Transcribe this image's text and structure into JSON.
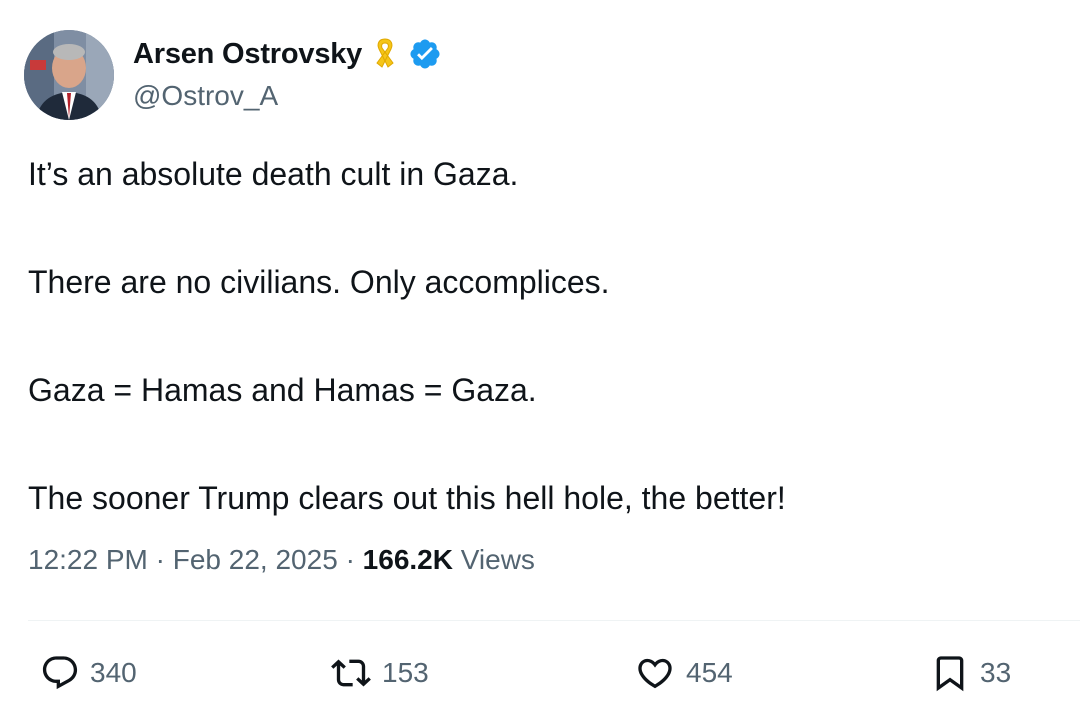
{
  "author": {
    "display_name": "Arsen Ostrovsky",
    "handle": "@Ostrov_A"
  },
  "tweet": {
    "paragraphs": [
      "It’s an absolute death cult in Gaza.",
      "There are no civilians. Only accomplices.",
      "Gaza = Hamas and Hamas = Gaza.",
      "The sooner Trump clears out this hell hole, the better!"
    ],
    "time": "12:22 PM",
    "separator": "·",
    "date": "Feb 22, 2025",
    "views_count": "166.2K",
    "views_label": "Views"
  },
  "actions": {
    "replies": "340",
    "reposts": "153",
    "likes": "454",
    "bookmarks": "33"
  },
  "icons": {
    "ribbon": "yellow-ribbon-icon",
    "verified": "verified-badge-icon",
    "reply": "reply-bubble-icon",
    "repost": "repost-arrows-icon",
    "like": "heart-icon",
    "bookmark": "bookmark-icon"
  },
  "colors": {
    "text_primary": "#0f1419",
    "text_secondary": "#536471",
    "verified_blue": "#1d9bf0",
    "ribbon_yellow": "#f5c518"
  }
}
